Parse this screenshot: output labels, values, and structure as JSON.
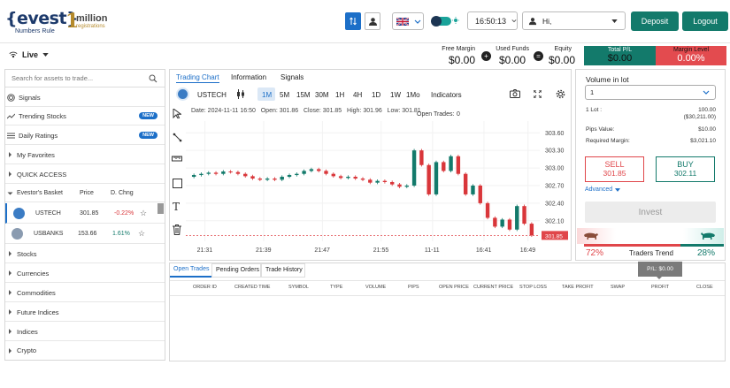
{
  "header": {
    "logo_text": "{evest}",
    "logo_tagline": "Numbers Rule",
    "million_one": "1",
    "million_text": "million",
    "million_sub": "registrations",
    "time": "16:50:13",
    "user_greeting": "Hi,",
    "deposit_label": "Deposit",
    "logout_label": "Logout"
  },
  "account": {
    "live_label": "Live",
    "free_margin_label": "Free Margin",
    "free_margin": "$0.00",
    "used_funds_label": "Used Funds",
    "used_funds": "$0.00",
    "equity_label": "Equity",
    "equity": "$0.00",
    "total_pl_label": "Total P/L",
    "total_pl": "$0.00",
    "margin_level_label": "Margin Level",
    "margin_level": "0.00%"
  },
  "sidebar": {
    "search_placeholder": "Search for assets to trade...",
    "items": [
      {
        "label": "Signals"
      },
      {
        "label": "Trending Stocks",
        "badge": "NEW"
      },
      {
        "label": "Daily Ratings",
        "badge": "NEW"
      },
      {
        "label": "My Favorites"
      },
      {
        "label": "QUICK ACCESS"
      }
    ],
    "basket_header": {
      "name": "Evestor's Basket",
      "price": "Price",
      "change": "D. Chng"
    },
    "basket_rows": [
      {
        "symbol": "USTECH",
        "price": "301.85",
        "change": "-0.22%"
      },
      {
        "symbol": "USBANKS",
        "price": "153.66",
        "change": "1.61%"
      }
    ],
    "categories": [
      "Stocks",
      "Currencies",
      "Commodities",
      "Future Indices",
      "Indices",
      "Crypto"
    ]
  },
  "chart_panel": {
    "tabs": [
      "Trading Chart",
      "Information",
      "Signals"
    ],
    "symbol": "USTECH",
    "timeframes": [
      "1M",
      "5M",
      "15M",
      "30M",
      "1H",
      "4H",
      "1D",
      "1W",
      "1Mo"
    ],
    "indicators_label": "Indicators",
    "ohlc_text": "Date: 2024-11-11 16:50   Open: 301.86   Close: 301.85   High: 301.96   Low: 301.81",
    "open_trades_label": "Open Trades:",
    "open_trades_count": "0",
    "last_price_tag": "301.85"
  },
  "chart_data": {
    "type": "candlestick",
    "x_ticks": [
      "21:31",
      "21:39",
      "21:47",
      "21:55",
      "11-11",
      "16:41",
      "16:49"
    ],
    "y_ticks": [
      "303.60",
      "303.30",
      "303.00",
      "302.70",
      "302.40",
      "302.10"
    ],
    "ylim": [
      301.75,
      303.8
    ],
    "candles": [
      {
        "o": 302.85,
        "c": 302.88
      },
      {
        "o": 302.88,
        "c": 302.9
      },
      {
        "o": 302.9,
        "c": 302.92
      },
      {
        "o": 302.92,
        "c": 302.9
      },
      {
        "o": 302.9,
        "c": 302.94
      },
      {
        "o": 302.94,
        "c": 302.93
      },
      {
        "o": 302.93,
        "c": 302.9
      },
      {
        "o": 302.9,
        "c": 302.86
      },
      {
        "o": 302.86,
        "c": 302.82
      },
      {
        "o": 302.82,
        "c": 302.8
      },
      {
        "o": 302.8,
        "c": 302.82
      },
      {
        "o": 302.82,
        "c": 302.8
      },
      {
        "o": 302.8,
        "c": 302.85
      },
      {
        "o": 302.85,
        "c": 302.88
      },
      {
        "o": 302.88,
        "c": 302.9
      },
      {
        "o": 302.9,
        "c": 302.95
      },
      {
        "o": 302.95,
        "c": 302.98
      },
      {
        "o": 302.98,
        "c": 302.95
      },
      {
        "o": 302.95,
        "c": 302.9
      },
      {
        "o": 302.9,
        "c": 302.86
      },
      {
        "o": 302.86,
        "c": 302.83
      },
      {
        "o": 302.83,
        "c": 302.85
      },
      {
        "o": 302.85,
        "c": 302.82
      },
      {
        "o": 302.82,
        "c": 302.8
      },
      {
        "o": 302.8,
        "c": 302.75
      },
      {
        "o": 302.75,
        "c": 302.78
      },
      {
        "o": 302.78,
        "c": 302.76
      },
      {
        "o": 302.76,
        "c": 302.72
      },
      {
        "o": 302.72,
        "c": 302.68
      },
      {
        "o": 302.68,
        "c": 302.7
      },
      {
        "o": 302.7,
        "c": 303.3
      },
      {
        "o": 303.3,
        "c": 303.05
      },
      {
        "o": 303.05,
        "c": 302.55
      },
      {
        "o": 302.55,
        "c": 303.1
      },
      {
        "o": 303.1,
        "c": 302.95
      },
      {
        "o": 302.95,
        "c": 303.2
      },
      {
        "o": 303.2,
        "c": 302.9
      },
      {
        "o": 302.9,
        "c": 302.55
      },
      {
        "o": 302.55,
        "c": 302.7
      },
      {
        "o": 302.7,
        "c": 302.4
      },
      {
        "o": 302.4,
        "c": 302.15
      },
      {
        "o": 302.15,
        "c": 302.0
      },
      {
        "o": 302.0,
        "c": 302.12
      },
      {
        "o": 302.12,
        "c": 301.95
      },
      {
        "o": 301.95,
        "c": 302.35
      },
      {
        "o": 302.35,
        "c": 302.05
      },
      {
        "o": 302.05,
        "c": 301.85
      }
    ]
  },
  "trade_panel": {
    "volume_label": "Volume in lot",
    "volume_value": "1",
    "lot_label": "1 Lot :",
    "lot_value": "100.00",
    "lot_value_usd": "($30,211.00)",
    "pips_label": "Pips Value:",
    "pips_value": "$10.00",
    "req_margin_label": "Required Margin:",
    "req_margin_value": "$3,021.10",
    "sell_label": "SELL",
    "sell_price": "301.85",
    "buy_label": "BUY",
    "buy_price": "302.11",
    "advanced_label": "Advanced",
    "invest_label": "Invest",
    "sell_pct": "72%",
    "buy_pct": "28%",
    "traders_trend_label": "Traders Trend",
    "colors": {
      "sell": "#e0464a",
      "buy": "#137a6b"
    }
  },
  "bottom": {
    "tabs": [
      "Open Trades",
      "Pending Orders",
      "Trade History"
    ],
    "pl_tooltip": "P/L: $0.00",
    "columns": [
      "ORDER ID",
      "CREATED TIME",
      "SYMBOL",
      "TYPE",
      "VOLUME",
      "PIPS",
      "OPEN PRICE",
      "CURRENT PRICE",
      "STOP LOSS",
      "TAKE PROFIT",
      "SWAP",
      "PROFIT",
      "CLOSE"
    ]
  }
}
